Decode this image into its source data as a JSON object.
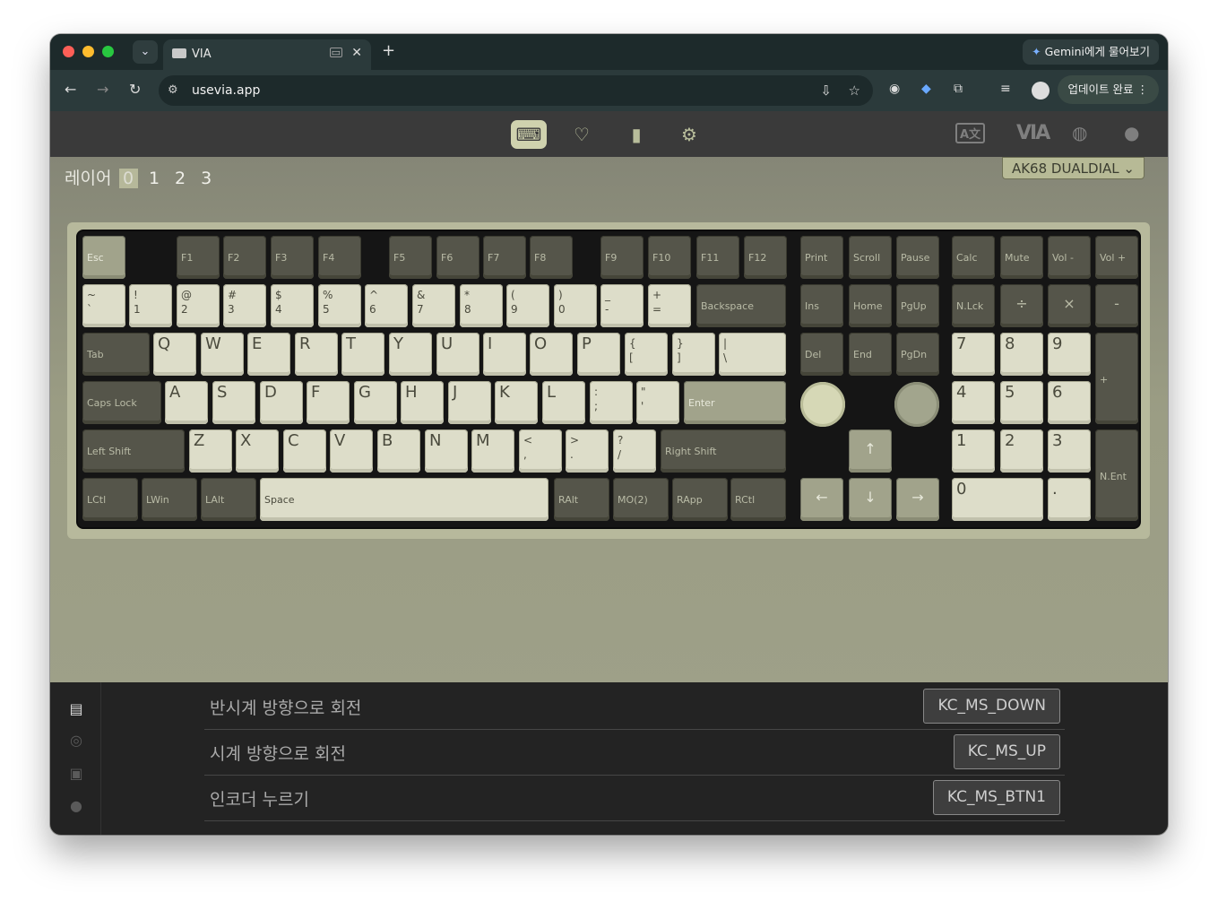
{
  "browser": {
    "tab_title": "VIA",
    "new_tab": "+",
    "close": "✕",
    "gemini_label": "Gemini에게 물어보기",
    "url": "usevia.app",
    "update_label": "업데이트 완료"
  },
  "app": {
    "nav": {
      "configure": "⌨",
      "test": "♡",
      "design": "▮",
      "settings": "⚙"
    },
    "layers": {
      "label": "레이어",
      "items": [
        "0",
        "1",
        "2",
        "3"
      ]
    },
    "keyboard_name": "AK68 DUALDIAL",
    "keys": {
      "esc": "Esc",
      "f1": "F1",
      "f2": "F2",
      "f3": "F3",
      "f4": "F4",
      "f5": "F5",
      "f6": "F6",
      "f7": "F7",
      "f8": "F8",
      "f9": "F9",
      "f10": "F10",
      "f11": "F11",
      "f12": "F12",
      "print": "Print",
      "scroll": "Scroll",
      "pause": "Pause",
      "calc": "Calc",
      "mute": "Mute",
      "voldown": "Vol -",
      "volup": "Vol +",
      "grave": [
        "~",
        "`"
      ],
      "n1": [
        "!",
        "1"
      ],
      "n2": [
        "@",
        "2"
      ],
      "n3": [
        "#",
        "3"
      ],
      "n4": [
        "$",
        "4"
      ],
      "n5": [
        "%",
        "5"
      ],
      "n6": [
        "^",
        "6"
      ],
      "n7": [
        "&",
        "7"
      ],
      "n8": [
        "*",
        "8"
      ],
      "n9": [
        "(",
        "9"
      ],
      "n0": [
        ")",
        "0"
      ],
      "minus": [
        "_",
        "-"
      ],
      "equal": [
        "+",
        "="
      ],
      "backspace": "Backspace",
      "ins": "Ins",
      "home": "Home",
      "pgup": "PgUp",
      "nlck": "N.Lck",
      "pdiv": "÷",
      "pmul": "×",
      "pminus": "-",
      "tab": "Tab",
      "q": "Q",
      "w": "W",
      "e": "E",
      "r": "R",
      "t": "T",
      "y": "Y",
      "u": "U",
      "i": "I",
      "o": "O",
      "p": "P",
      "lbr": [
        "{",
        "["
      ],
      "rbr": [
        "}",
        "]"
      ],
      "bslash": [
        "|",
        "\\"
      ],
      "del": "Del",
      "end": "End",
      "pgdn": "PgDn",
      "p7": "7",
      "p8": "8",
      "p9": "9",
      "pplus": "+",
      "caps": "Caps Lock",
      "a": "A",
      "s": "S",
      "d": "D",
      "f": "F",
      "g": "G",
      "h": "H",
      "j": "J",
      "k": "K",
      "l": "L",
      "semi": [
        ":",
        ";"
      ],
      "quote": [
        "\"",
        "'"
      ],
      "enter": "Enter",
      "p4": "4",
      "p5": "5",
      "p6": "6",
      "lshift": "Left Shift",
      "z": "Z",
      "x": "X",
      "c": "C",
      "v": "V",
      "b": "B",
      "n": "N",
      "m": "M",
      "comma": [
        "<",
        ","
      ],
      "dot": [
        ">",
        "."
      ],
      "slash": [
        "?",
        "/"
      ],
      "rshift": "Right Shift",
      "up": "↑",
      "p1": "1",
      "p2": "2",
      "p3": "3",
      "pent": "N.Ent",
      "lctl": "LCtl",
      "lwin": "LWin",
      "lalt": "LAlt",
      "space": "Space",
      "ralt": "RAlt",
      "mo2": "MO(2)",
      "rapp": "RApp",
      "rctl": "RCtl",
      "left": "←",
      "down": "↓",
      "right": "→",
      "p0": "0",
      "pdot": "."
    },
    "encoder_rows": [
      {
        "label": "반시계 방향으로 회전",
        "value": "KC_MS_DOWN"
      },
      {
        "label": "시계 방향으로 회전",
        "value": "KC_MS_UP"
      },
      {
        "label": "인코더 누르기",
        "value": "KC_MS_BTN1"
      }
    ]
  },
  "colors": {
    "accent": "#cfd2ae",
    "key_light": "#ddddc9",
    "key_dark": "#55554a",
    "key_sage": "#a1a38b"
  }
}
